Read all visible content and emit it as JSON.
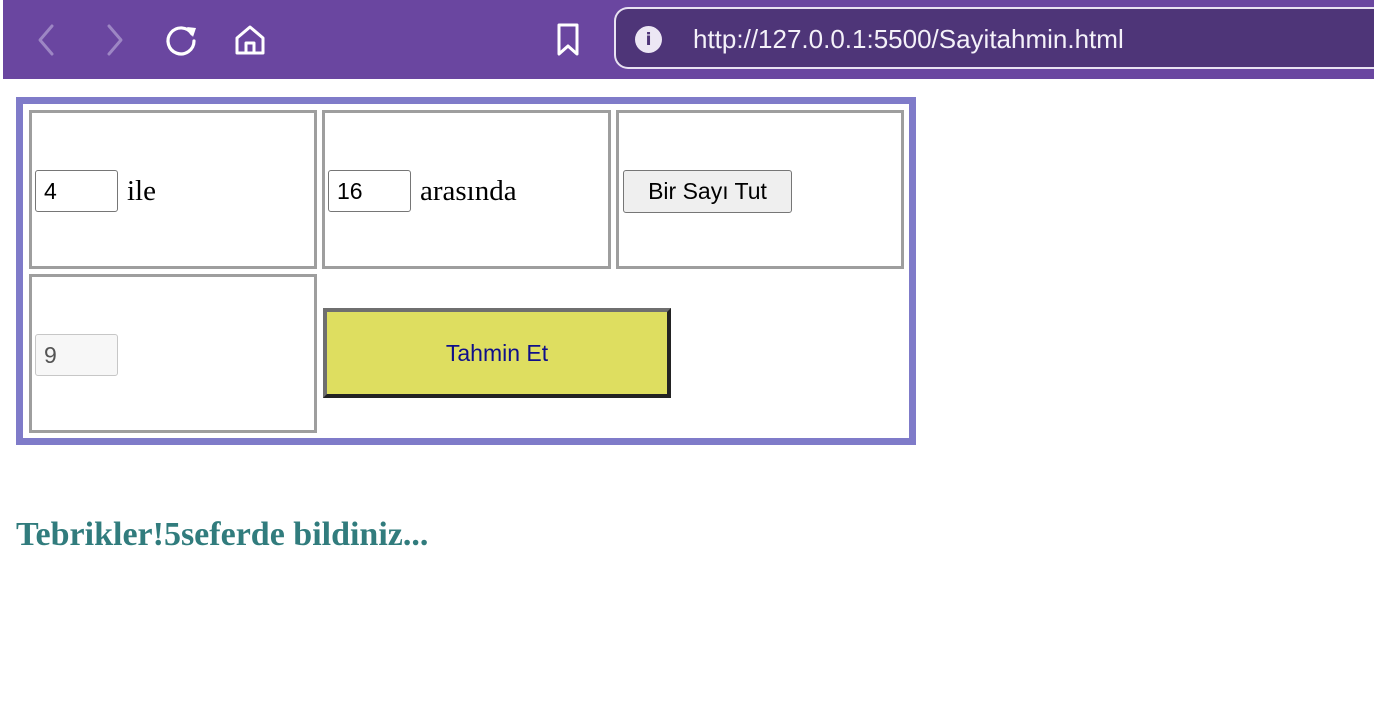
{
  "browser": {
    "url": "http://127.0.0.1:5500/Sayitahmin.html",
    "info_glyph": "i",
    "icons": [
      "back-arrow-icon",
      "forward-arrow-icon",
      "reload-icon",
      "home-icon",
      "bookmark-icon",
      "info-icon"
    ],
    "colors": {
      "toolbar": "#6a46a0",
      "urlbar": "#4e3578"
    }
  },
  "form": {
    "min_value": "4",
    "min_label": "ile",
    "max_value": "16",
    "max_label": "arasında",
    "pick_button_label": "Bir Sayı Tut",
    "guess_value": "9",
    "guess_button_label": "Tahmin Et",
    "colors": {
      "table_border": "#7f7bc9",
      "guess_button": "#dede60",
      "guess_button_text": "#0f0f8a"
    }
  },
  "result": {
    "message": "Tebrikler!5seferde bildiniz...",
    "color": "#317c7d"
  }
}
